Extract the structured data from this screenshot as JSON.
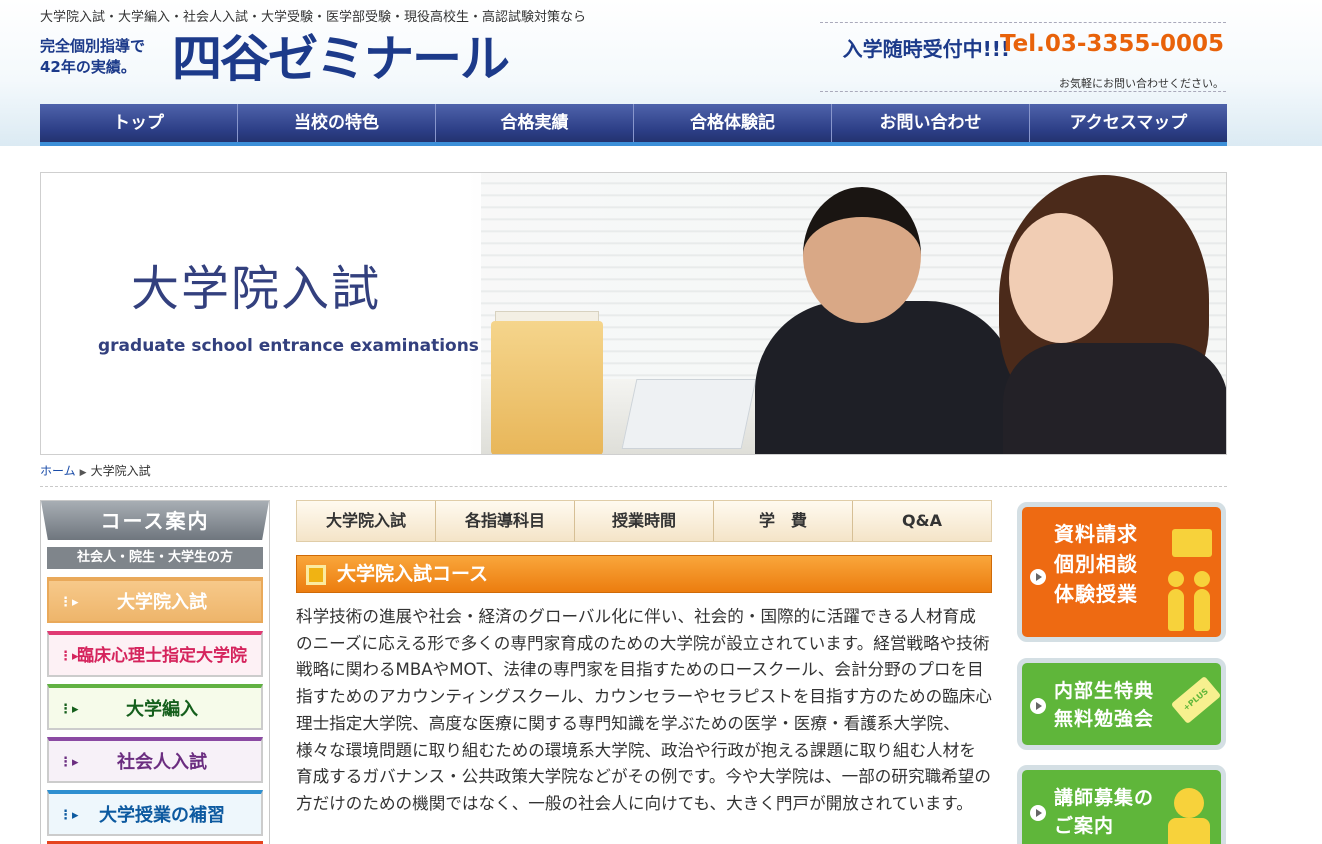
{
  "header": {
    "tagline": "大学院入試・大学編入・社会人入試・大学受験・医学部受験・現役高校生・高認試験対策なら",
    "logo_sub_line1": "完全個別指導で",
    "logo_sub_line2": "42年の実績。",
    "logo_main": "四谷ゼミナール",
    "admission_open": "入学随時受付中!!!",
    "tel": "Tel.03-3355-0005",
    "contact_note": "お気軽にお問い合わせください。"
  },
  "global_nav": [
    {
      "label": "トップ"
    },
    {
      "label": "当校の特色"
    },
    {
      "label": "合格実績"
    },
    {
      "label": "合格体験記"
    },
    {
      "label": "お問い合わせ"
    },
    {
      "label": "アクセスマップ"
    }
  ],
  "hero": {
    "title": "大学院入試",
    "subtitle": "graduate school entrance examinations"
  },
  "breadcrumb": {
    "home": "ホーム",
    "separator": "▶",
    "current": "大学院入試"
  },
  "sidebar": {
    "heading": "コース案内",
    "subheading": "社会人・院生・大学生の方",
    "items": [
      {
        "label": "大学院入試"
      },
      {
        "label": "臨床心理士指定大学院"
      },
      {
        "label": "大学編入"
      },
      {
        "label": "社会人入試"
      },
      {
        "label": "大学授業の補習"
      }
    ]
  },
  "content_tabs": [
    {
      "label": "大学院入試"
    },
    {
      "label": "各指導科目"
    },
    {
      "label": "授業時間"
    },
    {
      "label": "学　費"
    },
    {
      "label": "Q&A"
    }
  ],
  "section": {
    "title": "大学院入試コース",
    "body": "科学技術の進展や社会・経済のグローバル化に伴い、社会的・国際的に活躍できる人材育成のニーズに応える形で多くの専門家育成のための大学院が設立されています。経営戦略や技術戦略に関わるMBAやMOT、法律の専門家を目指すためのロースクール、会計分野のプロを目指すためのアカウンティングスクール、カウンセラーやセラピストを目指す方のための臨床心理士指定大学院、高度な医療に関する専門知識を学ぶための医学・医療・看護系大学院、様々な環境問題に取り組むための環境系大学院、政治や行政が抱える課題に取り組む人材を育成するガバナンス・公共政策大学院などがその例です。今や大学院は、一部の研究職希望の方だけのための機関ではなく、一般の社会人に向けても、大きく門戸が開放されています。"
  },
  "banners": [
    {
      "lines": [
        "資料請求",
        "個別相談",
        "体験授業"
      ],
      "color": "#ee6a12"
    },
    {
      "lines": [
        "内部生特典",
        "無料勉強会"
      ],
      "tag": "+PLUS",
      "color": "#5fb63a"
    },
    {
      "lines": [
        "講師募集の",
        "ご案内"
      ],
      "color": "#5fb63a"
    }
  ],
  "colors": {
    "brand_navy": "#1c3a8a",
    "tel_orange": "#e8620a",
    "nav_blue": "#2c3e86",
    "section_orange": "#ec7d0f"
  }
}
